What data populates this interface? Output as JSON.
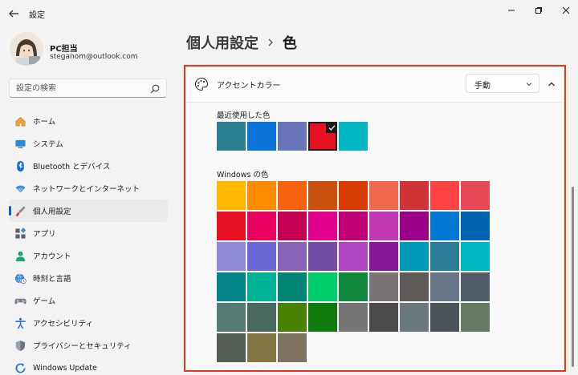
{
  "window": {
    "title": "設定",
    "controls": [
      "minimize-icon",
      "restore-icon",
      "close-icon"
    ]
  },
  "profile": {
    "name": "PC担当",
    "email": "steganom@outlook.com"
  },
  "search": {
    "placeholder": "設定の検索"
  },
  "nav": {
    "items": [
      {
        "label": "ホーム",
        "icon": "home-icon"
      },
      {
        "label": "システム",
        "icon": "monitor-icon"
      },
      {
        "label": "Bluetooth とデバイス",
        "icon": "bluetooth-icon"
      },
      {
        "label": "ネットワークとインターネット",
        "icon": "wifi-icon"
      },
      {
        "label": "個人用設定",
        "icon": "paintbrush-icon",
        "selected": true
      },
      {
        "label": "アプリ",
        "icon": "apps-icon"
      },
      {
        "label": "アカウント",
        "icon": "person-icon"
      },
      {
        "label": "時刻と言語",
        "icon": "globe-clock-icon"
      },
      {
        "label": "ゲーム",
        "icon": "gamepad-icon"
      },
      {
        "label": "アクセシビリティ",
        "icon": "accessibility-icon"
      },
      {
        "label": "プライバシーとセキュリティ",
        "icon": "shield-icon"
      },
      {
        "label": "Windows Update",
        "icon": "update-icon"
      }
    ]
  },
  "breadcrumb": {
    "parent": "個人用設定",
    "current": "色"
  },
  "accent": {
    "label": "アクセントカラー",
    "mode": "手動",
    "recent_label": "最近使用した色",
    "recent_colors": [
      "#2a7f91",
      "#0a74d8",
      "#6875b8",
      "#e81123",
      "#00b7c3"
    ],
    "recent_selected_index": 3,
    "windows_label": "Windows の色",
    "windows_colors": [
      "#ffb900",
      "#ff8c00",
      "#f7630c",
      "#ca5010",
      "#da3b01",
      "#ef6950",
      "#d13438",
      "#ff4343",
      "#e74856",
      "#e81123",
      "#ea005e",
      "#c30052",
      "#e3008c",
      "#bf0077",
      "#c239b3",
      "#9a0089",
      "#0078d4",
      "#0063b1",
      "#8e8cd8",
      "#6b69d6",
      "#8764b8",
      "#744da9",
      "#b146c2",
      "#881798",
      "#0099bc",
      "#2d7d9a",
      "#00b7c3",
      "#038387",
      "#00b294",
      "#018574",
      "#00cc6a",
      "#10893e",
      "#7a7574",
      "#5d5a58",
      "#68768a",
      "#515c6b",
      "#567c73",
      "#486860",
      "#498205",
      "#107c10",
      "#767676",
      "#4c4a48",
      "#69797e",
      "#4a5459",
      "#647c64",
      "#525e54",
      "#847545",
      "#7e735f"
    ]
  },
  "colors": {
    "accent_blue": "#0067c0",
    "highlight_red": "#e0391e"
  }
}
